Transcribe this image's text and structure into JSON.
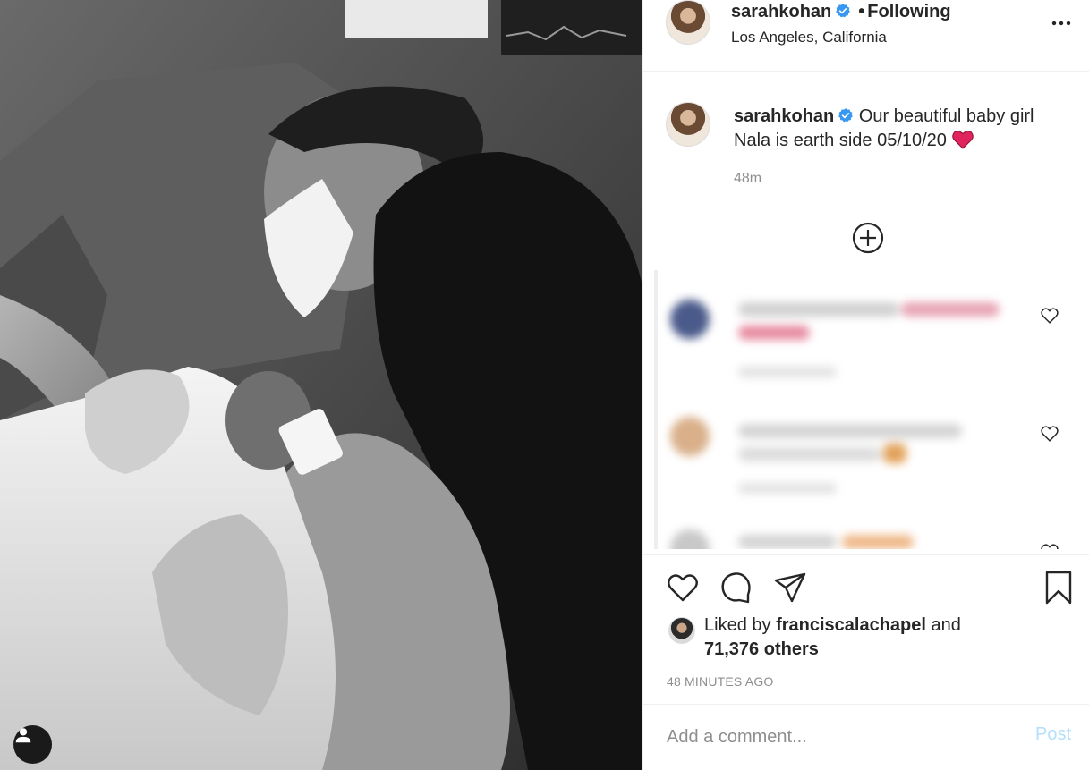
{
  "post": {
    "photo_description_icon": "baby-photo",
    "tag_icon": "user-tag-icon"
  },
  "header": {
    "username": "sarahkohan",
    "separator": "•",
    "follow_status": "Following",
    "location": "Los Angeles, California",
    "verified_icon": "verified-badge-icon",
    "more_icon": "more-options-icon"
  },
  "caption": {
    "username": "sarahkohan",
    "text": "Our beautiful baby girl Nala is earth side 05/10/20",
    "emoji": "❤️",
    "time": "48m"
  },
  "load_more_icon": "plus-circle-icon",
  "comments": [
    {
      "blurred": true
    },
    {
      "blurred": true
    },
    {
      "blurred": true
    }
  ],
  "actions": {
    "like_icon": "heart-icon",
    "comment_icon": "comment-icon",
    "share_icon": "share-icon",
    "save_icon": "bookmark-icon"
  },
  "likes": {
    "prefix": "Liked by",
    "liker": "franciscalachapel",
    "conjunction": "and",
    "others": "71,376 others"
  },
  "posted_time": "48 MINUTES AGO",
  "comment_form": {
    "placeholder": "Add a comment...",
    "post_label": "Post"
  },
  "colors": {
    "verified": "#3897f0",
    "post_disabled": "#b2dffc",
    "heart_emoji": "#e0245e",
    "muted_text": "#8e8e8e"
  }
}
